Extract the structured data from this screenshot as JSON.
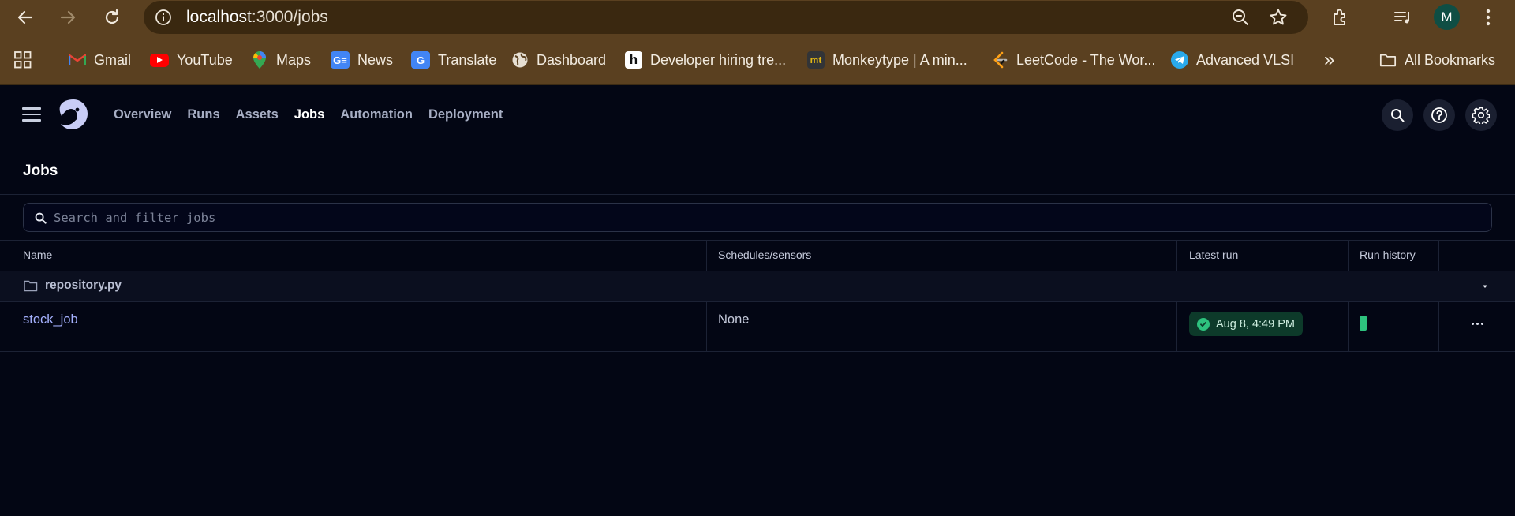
{
  "browser": {
    "url_host": "localhost",
    "url_path": ":3000/jobs",
    "profile_initial": "M",
    "bookmarks": [
      {
        "label": "Gmail",
        "icon": "gmail-icon"
      },
      {
        "label": "YouTube",
        "icon": "youtube-icon"
      },
      {
        "label": "Maps",
        "icon": "maps-icon"
      },
      {
        "label": "News",
        "icon": "news-icon"
      },
      {
        "label": "Translate",
        "icon": "translate-icon"
      },
      {
        "label": "Dashboard",
        "icon": "globe-icon"
      },
      {
        "label": "Developer hiring tre...",
        "icon": "hackerrank-icon"
      },
      {
        "label": "Monkeytype | A min...",
        "icon": "monkeytype-icon"
      },
      {
        "label": "LeetCode - The Wor...",
        "icon": "leetcode-icon"
      },
      {
        "label": "Advanced VLSI",
        "icon": "telegram-icon"
      }
    ],
    "all_bookmarks_label": "All Bookmarks",
    "bookmarks_overflow": "»"
  },
  "app": {
    "nav": [
      {
        "label": "Overview",
        "active": false
      },
      {
        "label": "Runs",
        "active": false
      },
      {
        "label": "Assets",
        "active": false
      },
      {
        "label": "Jobs",
        "active": true
      },
      {
        "label": "Automation",
        "active": false
      },
      {
        "label": "Deployment",
        "active": false
      }
    ],
    "page_title": "Jobs",
    "search": {
      "placeholder": "Search and filter jobs",
      "value": ""
    },
    "table": {
      "headers": [
        "Name",
        "Schedules/sensors",
        "Latest run",
        "Run history"
      ],
      "group": {
        "name": "repository.py"
      },
      "rows": [
        {
          "name": "stock_job",
          "schedules": "None",
          "latest_run": "Aug 8, 4:49 PM",
          "latest_run_status": "success",
          "run_history": [
            "success"
          ]
        }
      ]
    }
  },
  "colors": {
    "chrome": "#5a4020",
    "app_bg": "#030614",
    "link": "#a5b1ff",
    "success": "#2ec27e"
  }
}
